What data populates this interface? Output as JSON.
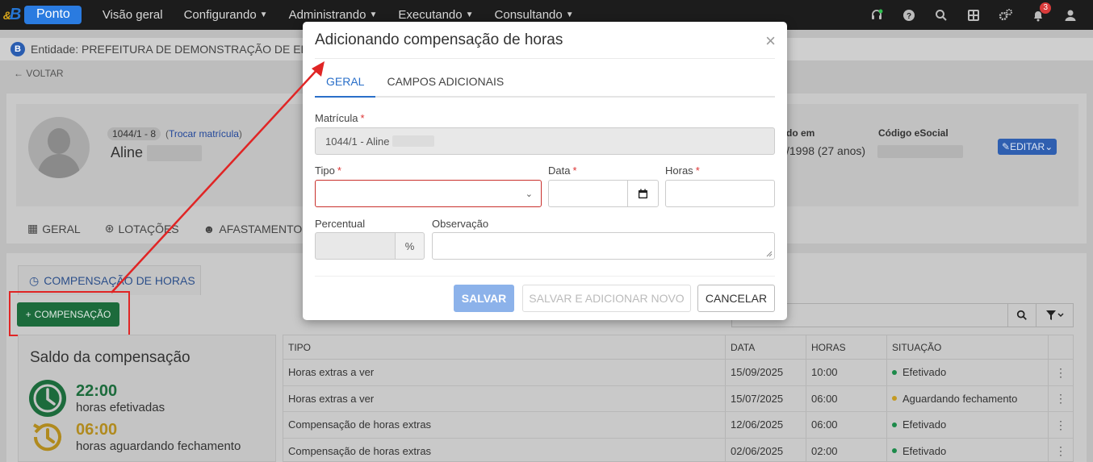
{
  "nav": {
    "brand_letter": "B",
    "brand_name": "Ponto",
    "items": [
      {
        "label": "Visão geral",
        "dropdown": false
      },
      {
        "label": "Configurando",
        "dropdown": true
      },
      {
        "label": "Administrando",
        "dropdown": true
      },
      {
        "label": "Executando",
        "dropdown": true
      },
      {
        "label": "Consultando",
        "dropdown": true
      }
    ],
    "notification_count": "3",
    "icons": [
      "headset-icon",
      "help-icon",
      "search-icon",
      "apps-grid-icon",
      "settings-icon",
      "bell-icon",
      "user-icon"
    ]
  },
  "entity": {
    "badge": "B",
    "text": "Entidade: PREFEITURA DE DEMONSTRAÇÃO DE EDIT"
  },
  "back_label": "VOLTAR",
  "profile": {
    "matricula_tag": "1044/1 - 8",
    "trocar_prefix": "(",
    "trocar_link": "Trocar matrícula",
    "trocar_suffix": ")",
    "name": "Aline",
    "birth_label": "do em",
    "birth_value": "/1998 (27 anos)",
    "esocial_label": "Código eSocial",
    "edit_label": "EDITAR"
  },
  "profile_tabs": [
    "GERAL",
    "LOTAÇÕES",
    "AFASTAMENTOS"
  ],
  "comp_tab_label": "COMPENSAÇÃO DE HORAS",
  "add_button_label": "COMPENSAÇÃO",
  "saldo": {
    "title": "Saldo da compensação",
    "rows": [
      {
        "hours": "22:00",
        "desc": "horas efetivadas",
        "color": "#1c6b3c"
      },
      {
        "hours": "06:00",
        "desc": "horas aguardando fechamento",
        "color": "#b08a1e"
      }
    ]
  },
  "table": {
    "headers": [
      "TIPO",
      "DATA",
      "HORAS",
      "SITUAÇÃO"
    ],
    "rows": [
      {
        "tipo": "Horas extras a ver",
        "data": "15/09/2025",
        "horas": "10:00",
        "situacao": "Efetivado",
        "status_color": "#1c8a4a"
      },
      {
        "tipo": "Horas extras a ver",
        "data": "15/07/2025",
        "horas": "06:00",
        "situacao": "Aguardando fechamento",
        "status_color": "#c49a22"
      },
      {
        "tipo": "Compensação de horas extras",
        "data": "12/06/2025",
        "horas": "06:00",
        "situacao": "Efetivado",
        "status_color": "#1c8a4a"
      },
      {
        "tipo": "Compensação de horas extras",
        "data": "02/06/2025",
        "horas": "02:00",
        "situacao": "Efetivado",
        "status_color": "#1c8a4a"
      }
    ]
  },
  "modal": {
    "title": "Adicionando compensação de horas",
    "close": "×",
    "tabs": [
      {
        "label": "GERAL",
        "active": true
      },
      {
        "label": "CAMPOS ADICIONAIS",
        "active": false
      }
    ],
    "matricula_label": "Matrícula",
    "matricula_value": "1044/1 - Aline",
    "tipo_label": "Tipo",
    "tipo_value": "",
    "data_label": "Data",
    "data_value": "",
    "horas_label": "Horas",
    "horas_value": "",
    "percentual_label": "Percentual",
    "percentual_value": "",
    "percent_symbol": "%",
    "observacao_label": "Observação",
    "observacao_value": "",
    "required_mark": "*",
    "save_label": "SALVAR",
    "save_new_label": "SALVAR E ADICIONAR NOVO",
    "cancel_label": "CANCELAR"
  },
  "colors": {
    "primary": "#2a6fc9",
    "success": "#1c6b3c",
    "annotation": "#e02525"
  }
}
